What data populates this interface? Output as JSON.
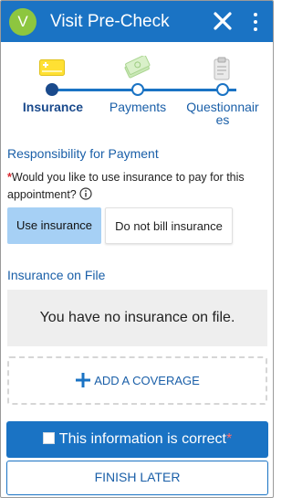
{
  "header": {
    "avatar_letter": "V",
    "title": "Visit Pre-Check",
    "close_icon": "close-icon",
    "menu_icon": "kebab-menu-icon",
    "background": "#1a73c4",
    "avatar_color": "#8dc63f"
  },
  "stepper": {
    "steps": [
      {
        "label": "Insurance",
        "icon": "insurance-card-icon",
        "active": true
      },
      {
        "label": "Payments",
        "icon": "money-icon",
        "active": false
      },
      {
        "label": "Questionnaires",
        "icon": "clipboard-icon",
        "active": false
      }
    ]
  },
  "responsibility": {
    "title": "Responsibility for Payment",
    "required_marker": "*",
    "question": "Would you like to use insurance to pay for this appointment?",
    "options": [
      "Use insurance",
      "Do not bill insurance"
    ],
    "selected": "Use insurance"
  },
  "insurance_on_file": {
    "title": "Insurance on File",
    "empty_message": "You have no insurance on file.",
    "add_label": "ADD A COVERAGE"
  },
  "footer": {
    "confirm_label": "This information is correct",
    "confirm_required": "*",
    "confirm_checked": false,
    "finish_label": "FINISH LATER"
  }
}
